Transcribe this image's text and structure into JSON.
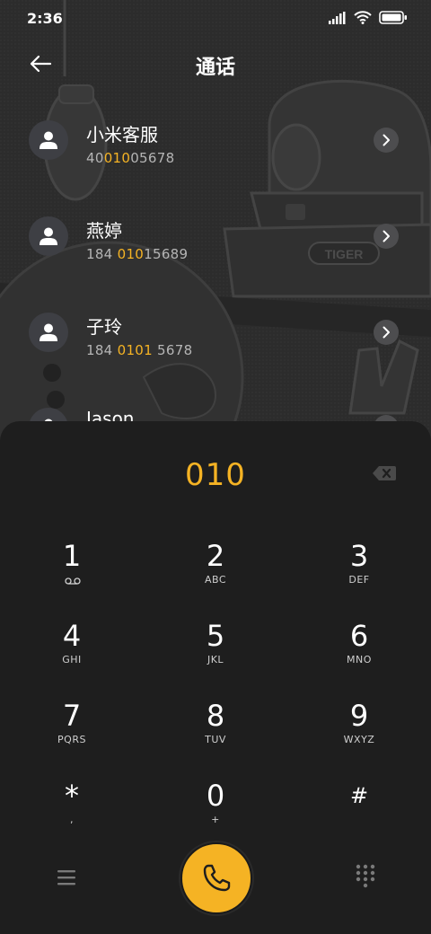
{
  "status_bar": {
    "time": "2:36"
  },
  "header": {
    "title": "通话"
  },
  "contacts": [
    {
      "name": "小米客服",
      "num_parts": [
        "40",
        "010",
        "05678"
      ],
      "num_hl": [
        false,
        true,
        false
      ]
    },
    {
      "name": "燕婷",
      "num_parts": [
        "184 ",
        "010",
        "15689"
      ],
      "num_hl": [
        false,
        true,
        false
      ]
    },
    {
      "name": "子玲",
      "num_parts": [
        "184 ",
        "0101",
        " 5678"
      ],
      "num_hl": [
        false,
        true,
        false
      ]
    },
    {
      "name": "Jason",
      "num_parts": [
        "",
        "",
        ""
      ],
      "num_hl": [
        false,
        false,
        false
      ]
    }
  ],
  "dialer": {
    "input": "010",
    "keys": [
      {
        "digit": "1",
        "letters": ""
      },
      {
        "digit": "2",
        "letters": "ABC"
      },
      {
        "digit": "3",
        "letters": "DEF"
      },
      {
        "digit": "4",
        "letters": "GHI"
      },
      {
        "digit": "5",
        "letters": "JKL"
      },
      {
        "digit": "6",
        "letters": "MNO"
      },
      {
        "digit": "7",
        "letters": "PQRS"
      },
      {
        "digit": "8",
        "letters": "TUV"
      },
      {
        "digit": "9",
        "letters": "WXYZ"
      },
      {
        "digit": "*",
        "letters": ","
      },
      {
        "digit": "0",
        "letters": "+"
      },
      {
        "digit": "#",
        "letters": ""
      }
    ]
  },
  "background_art": {
    "label": "TIGER"
  },
  "colors": {
    "accent": "#f5b324",
    "panel": "#1e1e1e",
    "background": "#2c2c2c"
  },
  "icons": {
    "back": "arrow-left-icon",
    "avatar": "person-icon",
    "chevron": "chevron-right-icon",
    "backspace": "backspace-icon",
    "voicemail": "voicemail-icon",
    "menu": "menu-icon",
    "call": "phone-icon",
    "dialpad": "dialpad-icon"
  }
}
